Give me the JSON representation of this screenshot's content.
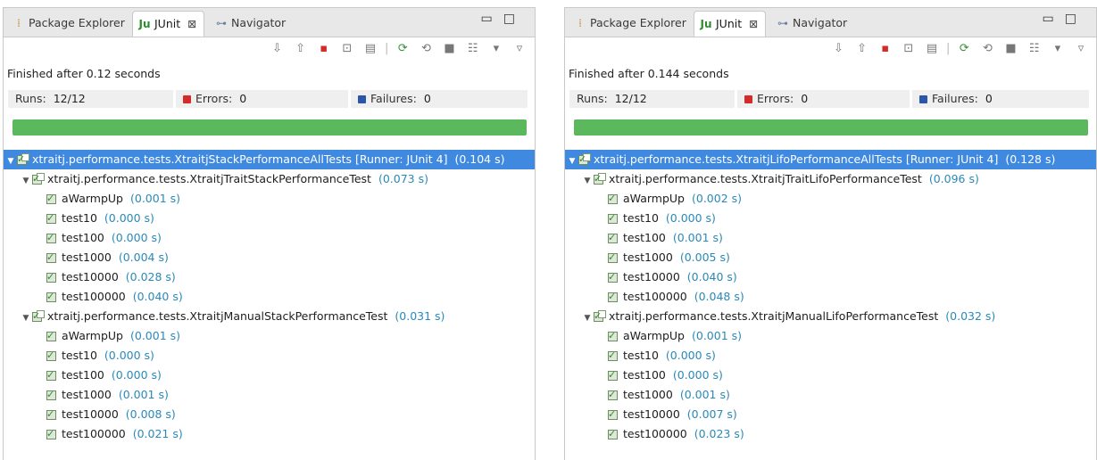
{
  "tabs": [
    {
      "label": "Package Explorer",
      "icon": "package-explorer-icon"
    },
    {
      "label": "JUnit",
      "icon": "junit-icon",
      "close": "⊠"
    },
    {
      "label": "Navigator",
      "icon": "navigator-icon"
    }
  ],
  "labels": {
    "runs": "Runs:",
    "errors": "Errors:",
    "failures": "Failures:"
  },
  "colors": {
    "progress": "#5cb85c",
    "selection": "#3f8ae0",
    "time": "#2a89b8"
  },
  "panels": [
    {
      "status": "Finished after 0.12 seconds",
      "runs": "12/12",
      "errors": "0",
      "failures": "0",
      "tree": [
        {
          "name": "xtraitj.performance.tests.XtraitjStackPerformanceAllTests [Runner: JUnit 4]",
          "time": "(0.104 s)"
        },
        {
          "name": "xtraitj.performance.tests.XtraitjTraitStackPerformanceTest",
          "time": "(0.073 s)"
        },
        {
          "name": "aWarmpUp",
          "time": "(0.001 s)"
        },
        {
          "name": "test10",
          "time": "(0.000 s)"
        },
        {
          "name": "test100",
          "time": "(0.000 s)"
        },
        {
          "name": "test1000",
          "time": "(0.004 s)"
        },
        {
          "name": "test10000",
          "time": "(0.028 s)"
        },
        {
          "name": "test100000",
          "time": "(0.040 s)"
        },
        {
          "name": "xtraitj.performance.tests.XtraitjManualStackPerformanceTest",
          "time": "(0.031 s)"
        },
        {
          "name": "aWarmpUp",
          "time": "(0.001 s)"
        },
        {
          "name": "test10",
          "time": "(0.000 s)"
        },
        {
          "name": "test100",
          "time": "(0.000 s)"
        },
        {
          "name": "test1000",
          "time": "(0.001 s)"
        },
        {
          "name": "test10000",
          "time": "(0.008 s)"
        },
        {
          "name": "test100000",
          "time": "(0.021 s)"
        }
      ]
    },
    {
      "status": "Finished after 0.144 seconds",
      "runs": "12/12",
      "errors": "0",
      "failures": "0",
      "tree": [
        {
          "name": "xtraitj.performance.tests.XtraitjLifoPerformanceAllTests [Runner: JUnit 4]",
          "time": "(0.128 s)"
        },
        {
          "name": "xtraitj.performance.tests.XtraitjTraitLifoPerformanceTest",
          "time": "(0.096 s)"
        },
        {
          "name": "aWarmpUp",
          "time": "(0.002 s)"
        },
        {
          "name": "test10",
          "time": "(0.000 s)"
        },
        {
          "name": "test100",
          "time": "(0.001 s)"
        },
        {
          "name": "test1000",
          "time": "(0.005 s)"
        },
        {
          "name": "test10000",
          "time": "(0.040 s)"
        },
        {
          "name": "test100000",
          "time": "(0.048 s)"
        },
        {
          "name": "xtraitj.performance.tests.XtraitjManualLifoPerformanceTest",
          "time": "(0.032 s)"
        },
        {
          "name": "aWarmpUp",
          "time": "(0.001 s)"
        },
        {
          "name": "test10",
          "time": "(0.000 s)"
        },
        {
          "name": "test100",
          "time": "(0.000 s)"
        },
        {
          "name": "test1000",
          "time": "(0.001 s)"
        },
        {
          "name": "test10000",
          "time": "(0.007 s)"
        },
        {
          "name": "test100000",
          "time": "(0.023 s)"
        }
      ]
    }
  ]
}
